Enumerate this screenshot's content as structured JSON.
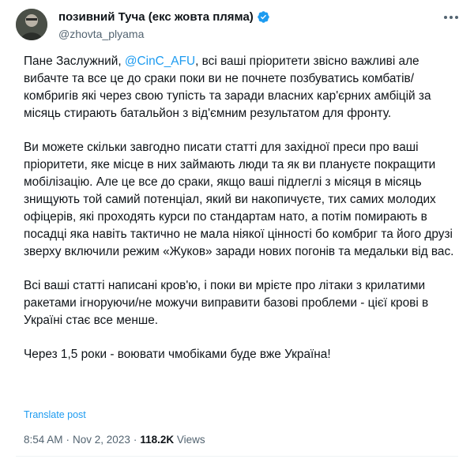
{
  "author": {
    "display_name": "позивний Туча (екс жовта пляма)",
    "handle": "@zhovta_plyama",
    "verified": true
  },
  "colors": {
    "accent": "#1d9bf0",
    "text": "#0f1419",
    "secondary": "#536471"
  },
  "body": {
    "p1_before": "Пане Заслужний, ",
    "mention": "@CinC_AFU",
    "p1_after": ", всі ваші пріоритети звісно важливі але вибачте та все це до сраки поки ви не почнете позбуватись комбатів/комбригів які через свою тупість та заради власних кар'єрних амбіцій за місяць стирають батальйон з від'ємним результатом для фронту.",
    "p2": "Ви можете скільки завгодно писати статті для західної преси про ваші пріоритети, яке місце в них займають люди та як ви плануєте покращити мобілізацію. Але це все до сраки, якщо ваші підлеглі з місяця в місяць знищують той самий потенціал, який ви накопичуєте, тих самих молодих офіцерів, які проходять курси по стандартам нато, а потім помирають в посадці яка навіть тактично не мала ніякої цінності бо комбриг та його друзі зверху включили режим «Жуков» заради нових погонів та медальки від вас.",
    "p3": "Всі ваші статті написані кров'ю, і поки ви мрієте про літаки з крилатими ракетами ігноруючи/не можучи виправити базові проблеми - цієї крові в Україні стає все менше.",
    "p4": "Через 1,5 роки - воювати чмобіками буде вже Україна!"
  },
  "translate_label": "Translate post",
  "meta": {
    "time": "8:54 AM",
    "separator": "·",
    "date": "Nov 2, 2023",
    "views_count": "118.2K",
    "views_label": "Views"
  },
  "icons": {
    "verified": "verified-badge-icon",
    "more": "more-options-icon"
  }
}
